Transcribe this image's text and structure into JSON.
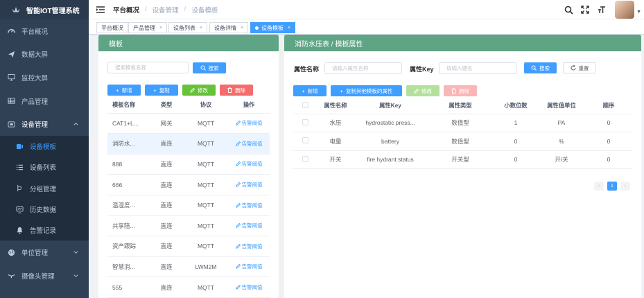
{
  "app": {
    "title": "智能IOT管理系统"
  },
  "sidebar": {
    "items": [
      {
        "label": "平台概况",
        "icon": "dashboard-icon"
      },
      {
        "label": "数据大屏",
        "icon": "send-icon"
      },
      {
        "label": "监控大屏",
        "icon": "monitor-icon"
      },
      {
        "label": "产品管理",
        "icon": "grid-icon"
      },
      {
        "label": "设备管理",
        "icon": "device-icon"
      }
    ],
    "sub_items": [
      {
        "label": "设备模板",
        "icon": "template-icon",
        "active": true
      },
      {
        "label": "设备列表",
        "icon": "list-icon"
      },
      {
        "label": "分组管理",
        "icon": "group-icon"
      },
      {
        "label": "历史数据",
        "icon": "history-icon"
      },
      {
        "label": "告警记录",
        "icon": "alarm-icon"
      }
    ],
    "bottom_items": [
      {
        "label": "单位管理",
        "icon": "globe-icon"
      },
      {
        "label": "摄像头管理",
        "icon": "camera-icon"
      }
    ]
  },
  "breadcrumb": {
    "items": [
      "平台概况",
      "设备管理",
      "设备模板"
    ]
  },
  "tags": [
    {
      "label": "平台概况",
      "closable": false
    },
    {
      "label": "产品管理",
      "closable": true
    },
    {
      "label": "设备列表",
      "closable": true
    },
    {
      "label": "设备详情",
      "closable": true
    },
    {
      "label": "设备模板",
      "closable": true,
      "active": true
    }
  ],
  "left_panel": {
    "title": "模板",
    "search_placeholder": "搜索模板名称",
    "search_button": "搜索",
    "buttons": {
      "add": "新增",
      "copy": "复制",
      "edit": "修改",
      "delete": "删除"
    },
    "columns": [
      "模板名称",
      "类型",
      "协议",
      "操作"
    ],
    "rows": [
      {
        "name": "CAT1+L...",
        "type": "网关",
        "protocol": "MQTT",
        "op": "告警阈值"
      },
      {
        "name": "消防水...",
        "type": "直连",
        "protocol": "MQTT",
        "op": "告警阈值",
        "selected": true
      },
      {
        "name": "888",
        "type": "直连",
        "protocol": "MQTT",
        "op": "告警阈值"
      },
      {
        "name": "666",
        "type": "直连",
        "protocol": "MQTT",
        "op": "告警阈值"
      },
      {
        "name": "温湿度...",
        "type": "直连",
        "protocol": "MQTT",
        "op": "告警阈值"
      },
      {
        "name": "共享陪...",
        "type": "直连",
        "protocol": "MQTT",
        "op": "告警阈值"
      },
      {
        "name": "资产跟踪",
        "type": "直连",
        "protocol": "MQTT",
        "op": "告警阈值"
      },
      {
        "name": "智慧消...",
        "type": "直连",
        "protocol": "LWM2M",
        "op": "告警阈值"
      },
      {
        "name": "555",
        "type": "直连",
        "protocol": "MQTT",
        "op": "告警阈值"
      }
    ]
  },
  "right_panel": {
    "title": "消防水压表 / 模板属性",
    "filters": {
      "name_label": "属性名称",
      "name_placeholder": "请输入属性名称",
      "key_label": "属性Key",
      "key_placeholder": "请输入键名",
      "search_button": "搜索",
      "reset_button": "重置"
    },
    "buttons": {
      "add": "新增",
      "copy_other": "复制其他模板的属性",
      "edit": "修改",
      "delete": "删除"
    },
    "columns": [
      "属性名称",
      "属性Key",
      "属性类型",
      "小数位数",
      "属性值单位",
      "顺序"
    ],
    "rows": [
      {
        "name": "水压",
        "key": "hydrostatic press...",
        "type": "数值型",
        "decimals": "1",
        "unit": "PA",
        "order": "0"
      },
      {
        "name": "电量",
        "key": "battery",
        "type": "数值型",
        "decimals": "0",
        "unit": "%",
        "order": "0"
      },
      {
        "name": "开关",
        "key": "fire hydrant status",
        "type": "开关型",
        "decimals": "0",
        "unit": "开/关",
        "order": "0"
      }
    ],
    "pagination": {
      "current": "1",
      "prev": "‹",
      "next": "›"
    }
  },
  "colors": {
    "sidebar_bg": "#304156",
    "accent": "#409eff",
    "panel_header": "#5fa585"
  }
}
